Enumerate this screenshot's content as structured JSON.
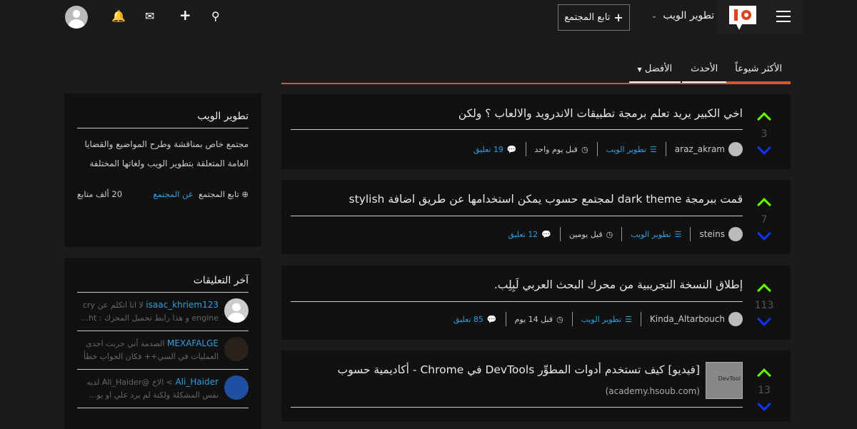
{
  "header": {
    "community": "تطوير الويب",
    "follow_label": "تابع المجتمع"
  },
  "tabs": [
    {
      "label": "الأكثر شيوعاً"
    },
    {
      "label": "الأحدث"
    },
    {
      "label": "الأفضل"
    }
  ],
  "posts": [
    {
      "title": "اخي الكبير يريد تعلم برمجة تطبيقات الاندرويد والالعاب ؟ ولكن",
      "votes": "3",
      "user": "araz_akram",
      "category": "تطوير الويب",
      "time": "قبل يوم واحد",
      "comments": "19 تعليق"
    },
    {
      "title": "قمت ببرمجة dark theme لمجتمع حسوب يمكن استخدامها عن طريق اضافة stylish",
      "votes": "7",
      "user": "steins",
      "category": "تطوير الويب",
      "time": "قبل يومين",
      "comments": "12 تعليق"
    },
    {
      "title": "إطلاق النسخة التجريبية من محرك البحث العربي لَبِلِب.",
      "votes": "113",
      "user": "Kinda_Altarbouch",
      "category": "تطوير الويب",
      "time": "قبل 14 يوم",
      "comments": "85 تعليق"
    },
    {
      "title": "[فيديو] كيف تستخدم أدوات المطوِّر DevTools في Chrome - أكاديمية حسوب",
      "votes": "13",
      "domain": "(academy.hsoub.com)",
      "thumb_text": "DevTool"
    }
  ],
  "sidebar": {
    "about": {
      "title": "تطوير الويب",
      "description": "مجتمع خاص بمناقشة وطرح المواضيع والقضايا العامة المتعلقة بتطوير الويب ولغاتها المختلفة",
      "follow": "تابع المجتمع",
      "about_link": "عن المجتمع",
      "followers": "20 ألف متابع"
    },
    "comments": {
      "title": "آخر التعليقات",
      "items": [
        {
          "user": "isaac_khriem123",
          "text": "لا انا اتكلم عن cry engine و هذا رابط تحميل المحرك : ht..."
        },
        {
          "user": "MEXAFALGE",
          "text": "الصدمة أني جربت احدى العمليات في السي++ فكان الجواب خطأ أ..."
        },
        {
          "user": "Ali_Haider",
          "text": "> الاخ @Ali_Haider لديه نفس المشكلة ولكنة لم يرد علي او يو..."
        }
      ]
    }
  },
  "colors": {
    "accent": "#d8572a",
    "link": "#2f9ee0",
    "upvote": "#66ff00",
    "downvote": "#1133ff"
  }
}
